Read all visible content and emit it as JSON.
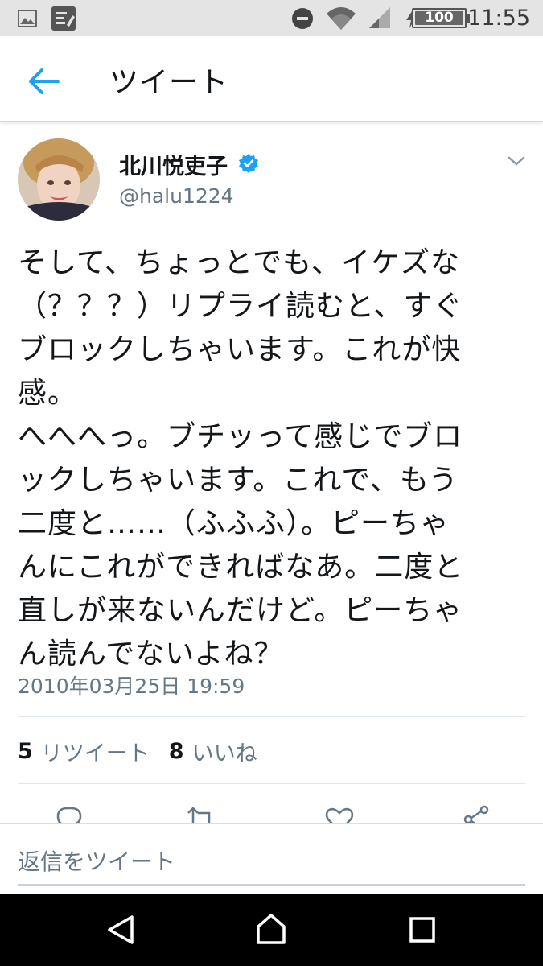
{
  "status_bar": {
    "time": "11:55",
    "battery_level": "100",
    "icons": [
      "image-icon",
      "note-icon",
      "do-not-disturb-icon",
      "wifi-icon",
      "signal-icon",
      "charging-icon",
      "battery-icon"
    ]
  },
  "app_bar": {
    "back_icon": "arrow-left-icon",
    "title": "ツイート"
  },
  "tweet": {
    "author": {
      "name": "北川悦吏子",
      "handle": "@halu1224",
      "verified": true
    },
    "text": "そして、ちょっとでも、イケズな\n（？？？）リプライ読むと、すぐ\nブロックしちゃいます。これが快\n感。\nへへへっ。ブチッって感じでブロ\nックしちゃいます。これで、もう\n二度と……（ふふふ）。ピーちゃ\nんにこれができればなあ。二度と\n直しが来ないんだけど。ピーちゃ\nん読んでないよね？",
    "timestamp": "2010年03月25日 19:59",
    "retweets": {
      "count": "5",
      "label": "リツイート"
    },
    "likes": {
      "count": "8",
      "label": "いいね"
    }
  },
  "actions": [
    "reply-icon",
    "retweet-icon",
    "like-icon",
    "share-icon"
  ],
  "reply": {
    "placeholder": "返信をツイート"
  },
  "nav_bar": {
    "buttons": [
      "back-triangle-icon",
      "home-circle-icon",
      "recents-square-icon"
    ]
  },
  "colors": {
    "accent": "#1da1f2",
    "text_primary": "#14171a",
    "text_secondary": "#657786",
    "status_bar_bg": "#e4e4e4",
    "nav_bar_bg": "#000000"
  }
}
